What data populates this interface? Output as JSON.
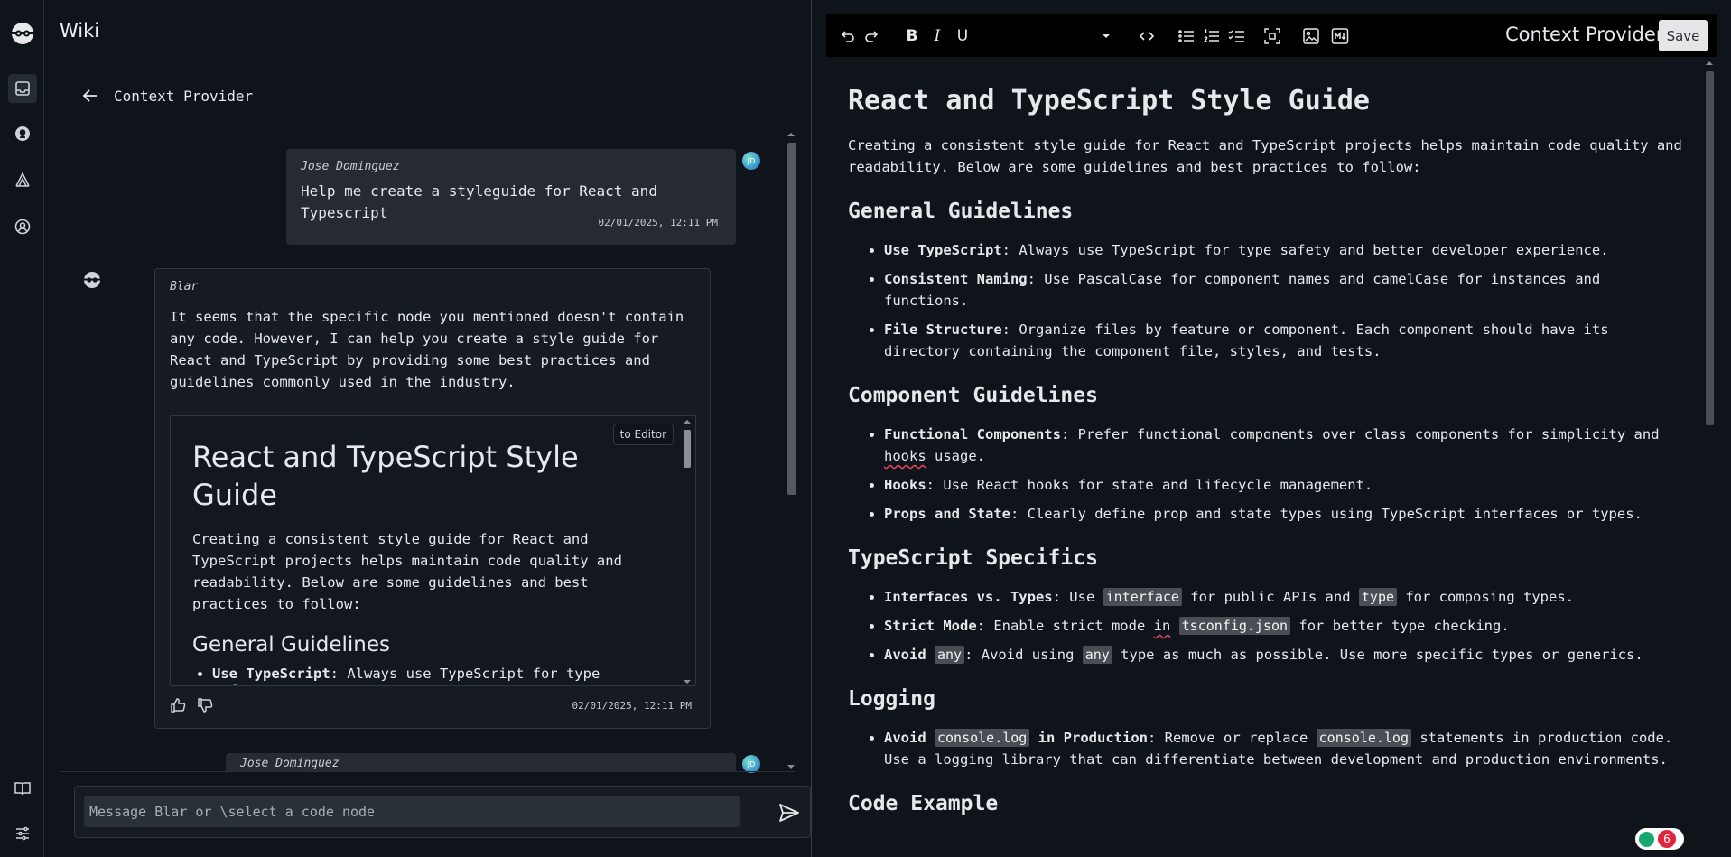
{
  "app": {
    "title": "Wiki"
  },
  "colors": {
    "accent": "#3d9bcf",
    "badge_red": "#e0263c",
    "badge_green": "#18a86e"
  },
  "rail": {
    "items": [
      {
        "icon": "inbox-icon",
        "active": true
      },
      {
        "icon": "github-icon"
      },
      {
        "icon": "graph-icon"
      },
      {
        "icon": "account-icon"
      }
    ],
    "bottom": [
      {
        "icon": "book-icon"
      },
      {
        "icon": "sliders-icon"
      }
    ]
  },
  "chat": {
    "header": "Context Provider",
    "messages": [
      {
        "author": "Jose Dominguez",
        "avatar": "JD",
        "text": "Help me create a styleguide for React and Typescript",
        "timestamp": "02/01/2025, 12:11 PM"
      },
      {
        "author": "Blar",
        "text": "It seems that the specific node you mentioned doesn't contain any code. However, I can help you create a style guide for React and TypeScript by providing some best practices and guidelines commonly used in the industry.",
        "embed": {
          "button": "to Editor",
          "title": "React and TypeScript Style Guide",
          "intro": "Creating a consistent style guide for React and TypeScript projects helps maintain code quality and readability. Below are some guidelines and best practices to follow:",
          "section": "General Guidelines",
          "first_item_bold": "Use TypeScript",
          "first_item_rest": ": Always use TypeScript for type safety"
        },
        "timestamp": "02/01/2025, 12:11 PM"
      },
      {
        "author": "Jose Dominguez",
        "avatar": "JD"
      }
    ],
    "composer": {
      "placeholder": "Message Blar or \\select a code node"
    }
  },
  "editor": {
    "title": "Context Provider",
    "save_label": "Save",
    "doc": {
      "title": "React and TypeScript Style Guide",
      "intro": "Creating a consistent style guide for React and TypeScript projects helps maintain code quality and readability. Below are some guidelines and best practices to follow:",
      "general": {
        "heading": "General Guidelines",
        "items": [
          {
            "bold": "Use TypeScript",
            "text": ": Always use TypeScript for type safety and better developer experience."
          },
          {
            "bold": "Consistent Naming",
            "text": ": Use PascalCase for component names and camelCase for instances and functions."
          },
          {
            "bold": "File Structure",
            "text": ": Organize files by feature or component. Each component should have its directory containing the component file, styles, and tests."
          }
        ]
      },
      "component": {
        "heading": "Component Guidelines",
        "items": [
          {
            "bold": "Functional Components",
            "text_a": ": Prefer functional components over class components for simplicity and ",
            "flag": "hooks",
            "text_b": " usage."
          },
          {
            "bold": "Hooks",
            "text": ": Use React hooks for state and lifecycle management."
          },
          {
            "bold": "Props and State",
            "text": ": Clearly define prop and state types using TypeScript interfaces or types."
          }
        ]
      },
      "typescript": {
        "heading": "TypeScript Specifics",
        "item1": {
          "bold": "Interfaces vs. Types",
          "a": ": Use ",
          "code1": "interface",
          "b": " for public APIs and ",
          "code2": "type",
          "c": " for composing types."
        },
        "item2": {
          "bold": "Strict Mode",
          "a": ": Enable strict mode ",
          "flag": "in",
          "code": "tsconfig.json",
          "b": " for better type checking."
        },
        "item3": {
          "bold": "Avoid ",
          "code1": "any",
          "a": ": Avoid using ",
          "code2": "any",
          "b": " type as much as possible. Use more specific types or generics."
        }
      },
      "logging": {
        "heading": "Logging",
        "item1": {
          "bold_a": "Avoid ",
          "code1": "console.log",
          "bold_b": " in Production",
          "a": ": Remove or replace ",
          "code2": "console.log",
          "b": " statements in production code. Use a logging library that can differentiate between development and production environments."
        }
      },
      "code_heading": "Code Example"
    }
  },
  "grammar_badge": {
    "count": "6"
  }
}
